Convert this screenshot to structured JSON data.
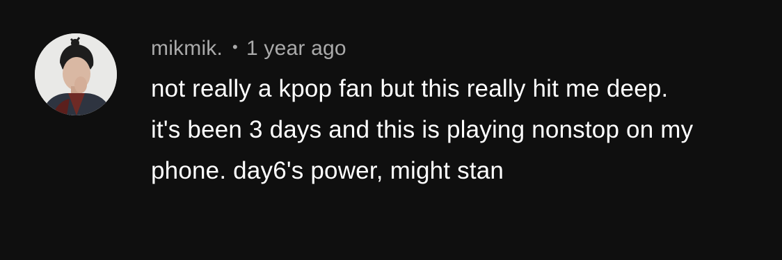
{
  "comment": {
    "author": "mikmik.",
    "separator": "•",
    "timestamp": "1 year ago",
    "text": "not really a kpop fan but this really hit me deep. it's been 3 days and this is playing nonstop on my phone. day6's power, might stan",
    "avatar_icon": "user-avatar-photo"
  },
  "colors": {
    "background": "#0f0f0f",
    "meta": "#aaaaaa",
    "text": "#ffffff",
    "avatar_bg": "#e9e9e7"
  }
}
